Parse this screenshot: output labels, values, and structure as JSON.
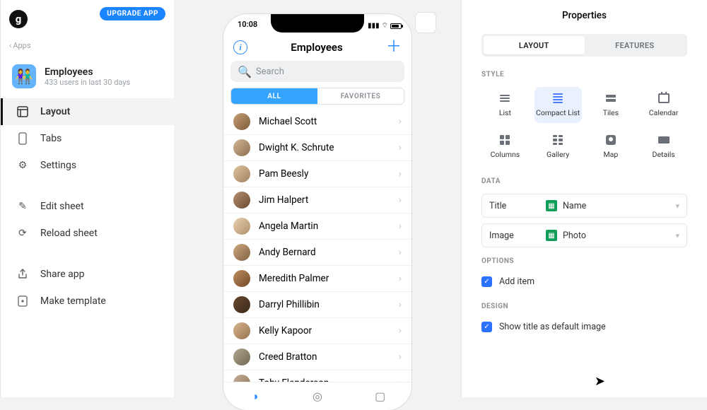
{
  "sidebar": {
    "upgrade_label": "UPGRADE APP",
    "logo_letter": "g",
    "back_label": "Apps",
    "app_name": "Employees",
    "app_sub": "433 users in last 30 days",
    "nav": {
      "layout": "Layout",
      "tabs": "Tabs",
      "settings": "Settings"
    },
    "actions": {
      "edit_sheet": "Edit sheet",
      "reload_sheet": "Reload sheet",
      "share_app": "Share app",
      "make_template": "Make template"
    }
  },
  "phone": {
    "time": "10:08",
    "title": "Employees",
    "search_placeholder": "Search",
    "seg_all": "ALL",
    "seg_fav": "FAVORITES",
    "employees": [
      "Michael Scott",
      "Dwight K. Schrute",
      "Pam Beesly",
      "Jim Halpert",
      "Angela Martin",
      "Andy Bernard",
      "Meredith Palmer",
      "Darryl Phillibin",
      "Kelly Kapoor",
      "Creed Bratton",
      "Toby Flanderson"
    ]
  },
  "panel": {
    "title": "Properties",
    "tab_layout": "LAYOUT",
    "tab_features": "FEATURES",
    "section_style": "STYLE",
    "styles": {
      "list": "List",
      "compact": "Compact List",
      "tiles": "Tiles",
      "calendar": "Calendar",
      "columns": "Columns",
      "gallery": "Gallery",
      "map": "Map",
      "details": "Details"
    },
    "section_data": "DATA",
    "data_title_key": "Title",
    "data_title_val": "Name",
    "data_image_key": "Image",
    "data_image_val": "Photo",
    "section_options": "OPTIONS",
    "option_add_item": "Add item",
    "section_design": "DESIGN",
    "design_show_title": "Show title as default image"
  }
}
